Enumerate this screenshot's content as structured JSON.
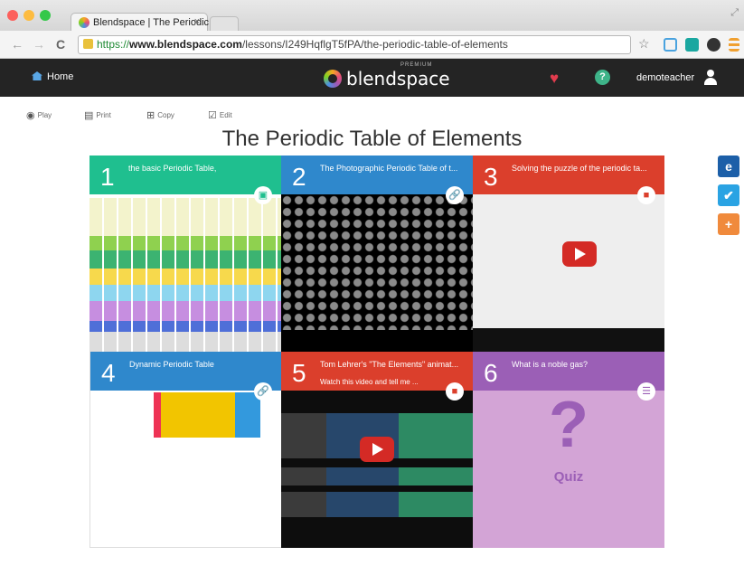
{
  "browser": {
    "tab_title": "Blendspace | The Periodic",
    "tab_close": "×",
    "url_prefix": "https://",
    "url_domain": "www.blendspace.com",
    "url_path": "/lessons/I249HqflgT5fPA/the-periodic-table-of-elements",
    "back": "←",
    "forward": "→",
    "reload": "C",
    "star": "☆"
  },
  "nav": {
    "home_label": "Home",
    "logo_text": "blendspace",
    "logo_tier": "PREMIUM",
    "username": "demoteacher",
    "help": "?"
  },
  "toolbar": {
    "play": "Play",
    "print": "Print",
    "copy": "Copy",
    "edit": "Edit"
  },
  "page_title": "The Periodic Table of Elements",
  "tiles": [
    {
      "num": "1",
      "caption": "the basic Periodic Table,",
      "sub": "",
      "color": "#1fbf8f",
      "badge_icon": "image-icon"
    },
    {
      "num": "2",
      "caption": "The Photographic Periodic Table of t...",
      "sub": "",
      "color": "#2f88cc",
      "badge_icon": "link-icon"
    },
    {
      "num": "3",
      "caption": "Solving the puzzle of the periodic ta...",
      "sub": "",
      "color": "#db3f2c",
      "badge_icon": "video-icon"
    },
    {
      "num": "4",
      "caption": "Dynamic Periodic Table",
      "sub": "",
      "color": "#2f88cc",
      "badge_icon": "link-icon"
    },
    {
      "num": "5",
      "caption": "Tom Lehrer's \"The Elements\" animat...",
      "sub": "Watch this video and tell me ...",
      "color": "#db3f2c",
      "badge_icon": "video-icon"
    },
    {
      "num": "6",
      "caption": "What is a noble gas?",
      "sub": "",
      "color": "#9b5fb6",
      "badge_icon": "quiz-list-icon"
    }
  ],
  "quiz": {
    "mark": "?",
    "label": "Quiz"
  },
  "social": {
    "e": "e",
    "plus": "+"
  },
  "colors": {
    "nav_bg": "#242424",
    "heart": "#e23c4e",
    "help": "#3eb489",
    "quiz_bg": "#d3a4d6"
  }
}
